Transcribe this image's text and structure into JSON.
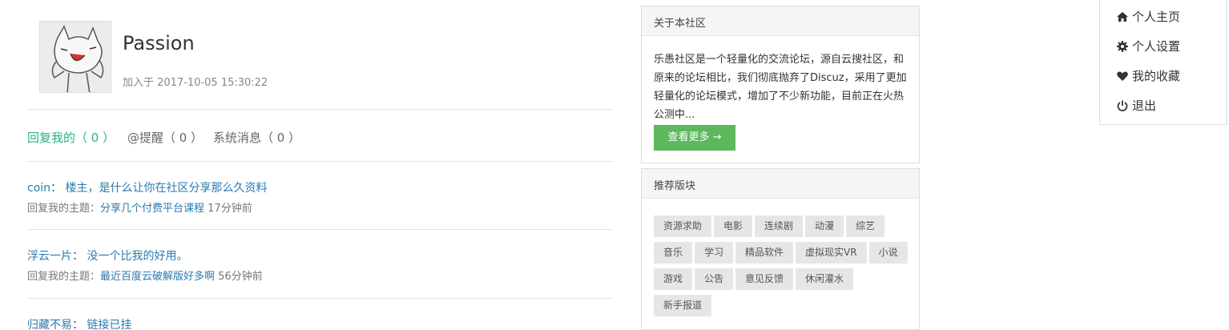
{
  "profile": {
    "username": "Passion",
    "joined": "加入于 2017-10-05 15:30:22"
  },
  "tabs": [
    {
      "label": "回复我的（ 0 ）",
      "active": true
    },
    {
      "label": "@提醒（ 0 ）",
      "active": false
    },
    {
      "label": "系统消息（ 0 ）",
      "active": false
    }
  ],
  "messages": [
    {
      "user": "coin",
      "sep": "：",
      "content": "楼主，是什么让你在社区分享那么久资料",
      "prefix": "回复我的主题：",
      "topic": "分享几个付费平台课程",
      "time": "17分钟前"
    },
    {
      "user": "浮云一片",
      "sep": "：",
      "content": "没一个比我的好用。",
      "prefix": "回复我的主题：",
      "topic": "最近百度云破解版好多啊",
      "time": "56分钟前"
    },
    {
      "user": "归藏不易",
      "sep": "：",
      "content": "链接已挂"
    }
  ],
  "about": {
    "title": "关于本社区",
    "text": "乐愚社区是一个轻量化的交流论坛，源自云搜社区，和原来的论坛相比，我们彻底抛弃了Discuz，采用了更加轻量化的论坛模式，增加了不少新功能，目前正在火热公测中...",
    "button": "查看更多 →"
  },
  "recommend": {
    "title": "推荐版块",
    "tags": [
      "资源求助",
      "电影",
      "连续剧",
      "动漫",
      "综艺",
      "音乐",
      "学习",
      "精品软件",
      "虚拟现实VR",
      "小说",
      "游戏",
      "公告",
      "意见反馈",
      "休闲灌水",
      "新手报道"
    ]
  },
  "menu": [
    {
      "label": "个人主页",
      "icon": "home-icon"
    },
    {
      "label": "个人设置",
      "icon": "gear-icon"
    },
    {
      "label": "我的收藏",
      "icon": "heart-icon"
    },
    {
      "label": "退出",
      "icon": "power-icon"
    }
  ],
  "colors": {
    "accent": "#2eb082",
    "link": "#2a7ab0",
    "button": "#5cb85c"
  }
}
